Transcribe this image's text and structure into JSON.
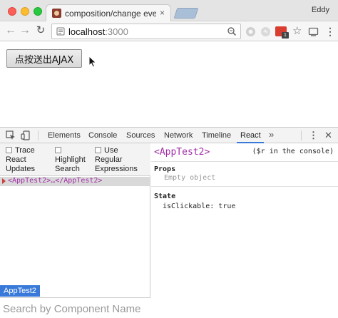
{
  "window": {
    "tab_title": "composition/change events te",
    "tab_close": "×",
    "profile_name": "Eddy"
  },
  "toolbar": {
    "url_host": "localhost",
    "url_port": ":3000",
    "extension_badge": "1",
    "bookmark_star": "☆",
    "menu": "⋮"
  },
  "page": {
    "ajax_button_label": "点按送出AJAX"
  },
  "devtools": {
    "tabs": [
      {
        "label": "Elements"
      },
      {
        "label": "Console"
      },
      {
        "label": "Sources"
      },
      {
        "label": "Network"
      },
      {
        "label": "Timeline"
      },
      {
        "label": "React"
      }
    ],
    "active_tab": "React",
    "more_tabs": "»",
    "menu": "⋮",
    "close": "✕",
    "options": {
      "trace_label": "Trace",
      "react_updates_label": "React Updates",
      "react_updates_line1": "React",
      "react_updates_line2": "Updates",
      "highlight_search_line1": "Highlight",
      "highlight_search_line2": "Search",
      "use_label": "Use",
      "regular_expressions_line1": "Regular",
      "regular_expressions_line2": "Expressions"
    },
    "tree_row": "<AppTest2>…</AppTest2>",
    "breadcrumb": "AppTest2",
    "search_placeholder": "Search by Component Name",
    "inspector": {
      "component_name": "<AppTest2>",
      "console_hint": "($r in the console)",
      "props_title": "Props",
      "props_empty": "Empty object",
      "state_title": "State",
      "state_key": "isClickable",
      "state_separator": ": ",
      "state_value": "true"
    }
  },
  "colors": {
    "accent_blue": "#3879d9",
    "component_purple": "#a12ea6",
    "close_red": "#fc5f57",
    "minimize_yellow": "#fdbc2e",
    "zoom_green": "#28c840"
  }
}
